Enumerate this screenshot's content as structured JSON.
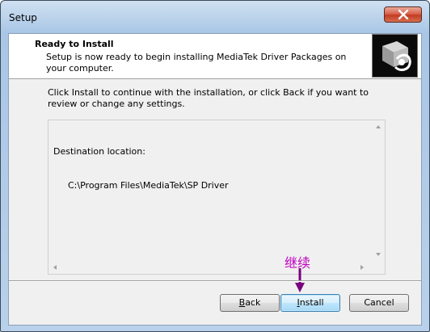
{
  "window": {
    "title": "Setup"
  },
  "header": {
    "title": "Ready to Install",
    "description": "Setup is now ready to begin installing MediaTek Driver Packages on your computer."
  },
  "body": {
    "instructions": "Click Install to continue with the installation, or click Back if you want to review or change any settings.",
    "details_label": "Destination location:",
    "details_path": "C:\\Program Files\\MediaTek\\SP Driver"
  },
  "annotation": {
    "label": "继续",
    "color": "#c000c0"
  },
  "buttons": {
    "back": {
      "accel": "B",
      "rest": "ack"
    },
    "install": {
      "accel": "I",
      "rest": "nstall"
    },
    "cancel": "Cancel"
  },
  "icons": {
    "close": "close-icon",
    "header": "install-package-icon"
  }
}
